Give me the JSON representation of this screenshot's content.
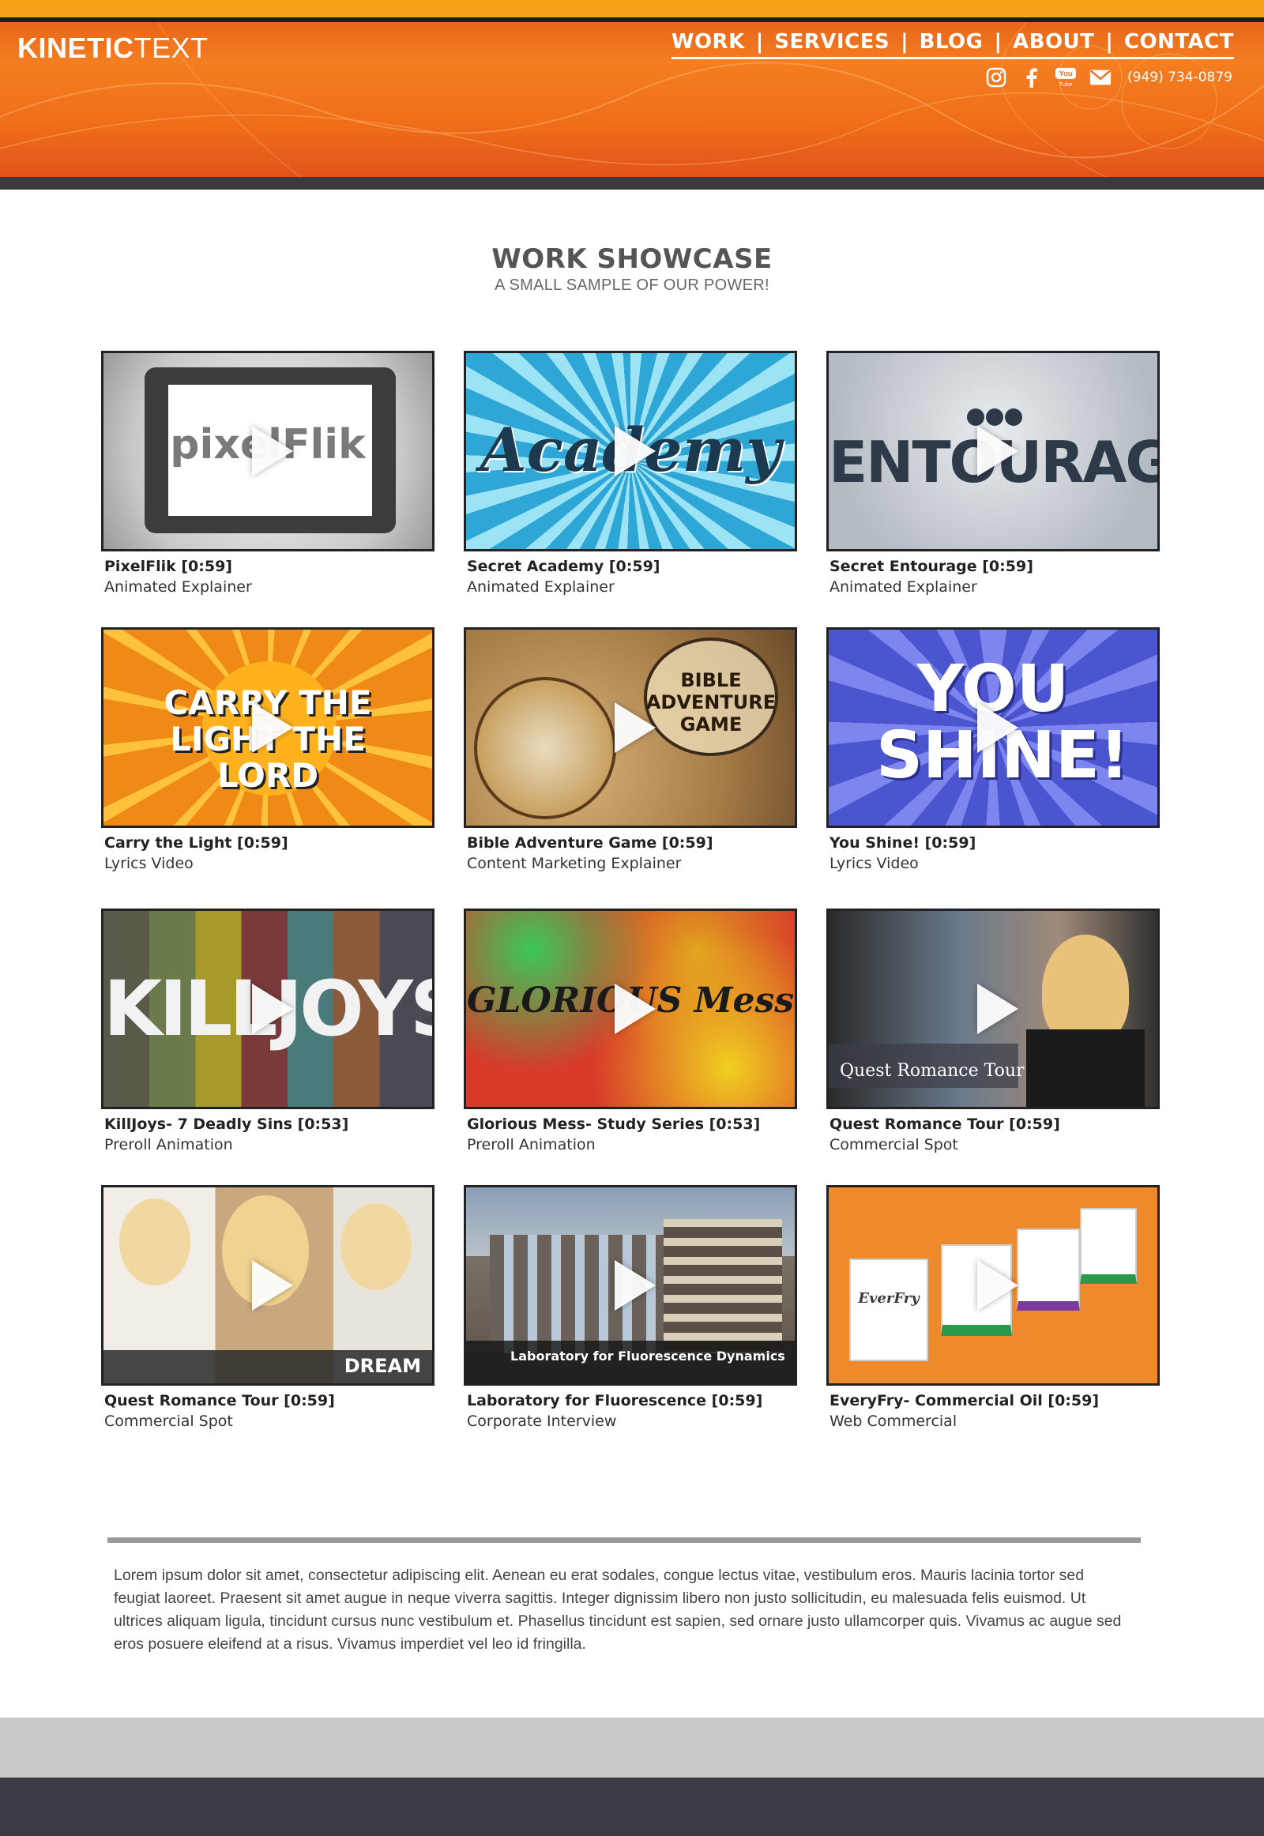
{
  "brand": {
    "bold": "KINETIC",
    "light": "TEXT"
  },
  "nav": [
    {
      "label": "WORK"
    },
    {
      "label": "SERVICES"
    },
    {
      "label": "BLOG"
    },
    {
      "label": "ABOUT"
    },
    {
      "label": "CONTACT"
    }
  ],
  "nav_separator": "|",
  "social": {
    "icons": [
      "instagram-icon",
      "facebook-icon",
      "youtube-icon",
      "email-icon"
    ],
    "youtube_top": "You",
    "youtube_bottom": "Tube",
    "phone": "(949) 734-0879"
  },
  "showcase": {
    "title": "WORK SHOWCASE",
    "subtitle": "A SMALL SAMPLE OF OUR POWER!"
  },
  "videos": [
    {
      "title": "PixelFlik [0:59]",
      "category": "Animated Explainer",
      "thumb_text": "pixelFlik",
      "theme": "#d9d9d9"
    },
    {
      "title": "Secret Academy [0:59]",
      "category": "Animated Explainer",
      "thumb_text": "Academy",
      "theme": "#3fb3d9"
    },
    {
      "title": "Secret Entourage [0:59]",
      "category": "Animated Explainer",
      "thumb_text": "ENTOURAGE",
      "theme": "#b8bec6"
    },
    {
      "title": "Carry the Light [0:59]",
      "category": "Lyrics Video",
      "thumb_text": "CARRY THE LIGHT THE LORD",
      "theme": "#f08a16"
    },
    {
      "title": "Bible Adventure Game [0:59]",
      "category": "Content Marketing Explainer",
      "thumb_text": "BIBLE ADVENTURE GAME",
      "theme": "#b9925c"
    },
    {
      "title": "You Shine! [0:59]",
      "category": "Lyrics Video",
      "thumb_text": "YOU SHINE!",
      "theme": "#5a63d8"
    },
    {
      "title": "KillJoys- 7 Deadly Sins [0:53]",
      "category": "Preroll Animation",
      "thumb_text": "KILLJOYS",
      "theme": "#6b5a4a"
    },
    {
      "title": "Glorious Mess-  Study Series [0:53]",
      "category": "Preroll Animation",
      "thumb_text": "GLORIOUS Mess",
      "theme": "#d84a2a"
    },
    {
      "title": "Quest Romance Tour [0:59]",
      "category": "Commercial Spot",
      "thumb_text": "Quest Romance Tour",
      "theme": "#6a7a8c"
    },
    {
      "title": "Quest Romance Tour [0:59]",
      "category": "Commercial Spot",
      "thumb_text": "DREAM",
      "theme": "#d8c9b0"
    },
    {
      "title": "Laboratory for Fluorescence [0:59]",
      "category": "Corporate Interview",
      "thumb_text": "Laboratory for Fluorescence Dynamics",
      "theme": "#7a7166"
    },
    {
      "title": "EveryFry- Commercial Oil [0:59]",
      "category": "Web Commercial",
      "thumb_text": "EverFry",
      "theme": "#ee8a2c"
    }
  ],
  "footer": {
    "body": "Lorem ipsum dolor sit amet, consectetur adipiscing elit. Aenean eu erat sodales, congue lectus vitae, vestibulum eros. Mauris lacinia tortor sed feugiat laoreet. Praesent sit amet augue in neque viverra sagittis. Integer dignissim libero non justo sollicitudin, eu malesuada felis euismod. Ut ultrices aliquam ligula, tincidunt cursus nunc vestibulum et. Phasellus tincidunt est sapien, sed ornare justo ullamcorper quis. Vivamus ac augue sed eros posuere eleifend at a risus. Vivamus imperdiet vel leo id fringilla."
  },
  "colors": {
    "header_orange": "#f47e20",
    "top_strip": "#f7a11b",
    "dark_bar": "#3a3a3a",
    "footer_gray": "#c8c8c8",
    "footer_dark": "#3b3b46"
  }
}
